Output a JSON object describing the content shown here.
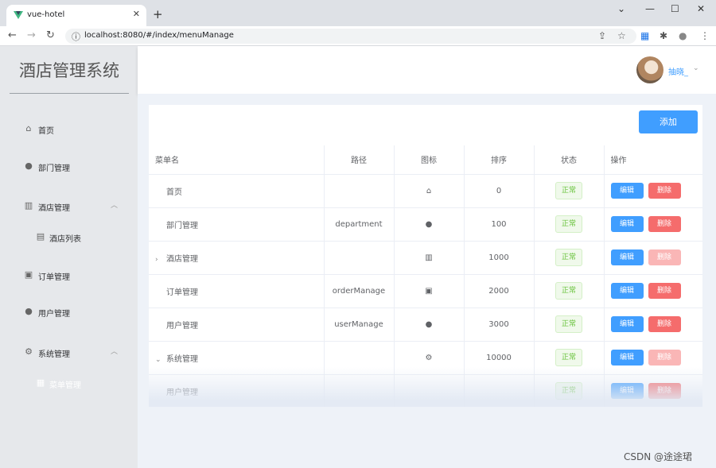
{
  "browser": {
    "tab_title": "vue-hotel",
    "tab_close": "✕",
    "new_tab": "+",
    "url": "localhost:8080/#/index/menuManage",
    "window_controls": [
      "⌄",
      "—",
      "☐",
      "✕"
    ],
    "nav": {
      "back": "←",
      "forward": "→",
      "reload": "↻",
      "info": "ⓘ"
    },
    "toolbar_icons": [
      "⇪",
      "☆",
      "▦",
      "✱",
      "●",
      "⋮"
    ]
  },
  "sidebar": {
    "brand": "酒店管理系统",
    "items": [
      {
        "label": "首页",
        "icon": "home-icon",
        "glyph": "⌂"
      },
      {
        "label": "部门管理",
        "icon": "user-icon",
        "glyph": "●"
      },
      {
        "label": "酒店管理",
        "icon": "office-building-icon",
        "glyph": "▥",
        "arrow": "︿"
      },
      {
        "label": "酒店列表",
        "icon": "document-icon",
        "glyph": "▤",
        "sub": true
      },
      {
        "label": "订单管理",
        "icon": "clipboard-icon",
        "glyph": "▣"
      },
      {
        "label": "用户管理",
        "icon": "user-icon",
        "glyph": "●"
      },
      {
        "label": "系统管理",
        "icon": "setting-icon",
        "glyph": "⚙",
        "arrow": "︿"
      },
      {
        "label": "菜单管理",
        "icon": "menu-grid-icon",
        "glyph": "▦",
        "sub": true,
        "active": true
      }
    ]
  },
  "header": {
    "username": "抽晓_",
    "dropdown_arrow": "⌄"
  },
  "main": {
    "add_button": "添加",
    "columns": [
      "菜单名",
      "路径",
      "图标",
      "排序",
      "状态",
      "操作"
    ],
    "rows": [
      {
        "name": "首页",
        "path": "",
        "icon": "⌂",
        "icon_name": "home-icon",
        "sort": "0",
        "status": "正常",
        "edit": "编辑",
        "delete": "删除",
        "delete_disabled": false,
        "expander": ""
      },
      {
        "name": "部门管理",
        "path": "department",
        "icon": "●",
        "icon_name": "user-icon",
        "sort": "100",
        "status": "正常",
        "edit": "编辑",
        "delete": "删除",
        "delete_disabled": false,
        "expander": ""
      },
      {
        "name": "酒店管理",
        "path": "",
        "icon": "▥",
        "icon_name": "office-building-icon",
        "sort": "1000",
        "status": "正常",
        "edit": "编辑",
        "delete": "删除",
        "delete_disabled": true,
        "expander": "›"
      },
      {
        "name": "订单管理",
        "path": "orderManage",
        "icon": "▣",
        "icon_name": "clipboard-icon",
        "sort": "2000",
        "status": "正常",
        "edit": "编辑",
        "delete": "删除",
        "delete_disabled": false,
        "expander": ""
      },
      {
        "name": "用户管理",
        "path": "userManage",
        "icon": "●",
        "icon_name": "user-icon",
        "sort": "3000",
        "status": "正常",
        "edit": "编辑",
        "delete": "删除",
        "delete_disabled": false,
        "expander": ""
      },
      {
        "name": "系统管理",
        "path": "",
        "icon": "⚙",
        "icon_name": "setting-icon",
        "sort": "10000",
        "status": "正常",
        "edit": "编辑",
        "delete": "删除",
        "delete_disabled": true,
        "expander": "⌄"
      },
      {
        "name": "用户管理",
        "path": "",
        "icon": "",
        "icon_name": "",
        "sort": "",
        "status": "正常",
        "edit": "编辑",
        "delete": "删除",
        "delete_disabled": false,
        "expander": ""
      }
    ]
  },
  "watermark": "CSDN @途途珺",
  "colors": {
    "primary": "#409eff",
    "danger": "#f56c6c",
    "success": "#67c23a",
    "sidebar_bg": "#e6e8eb"
  }
}
